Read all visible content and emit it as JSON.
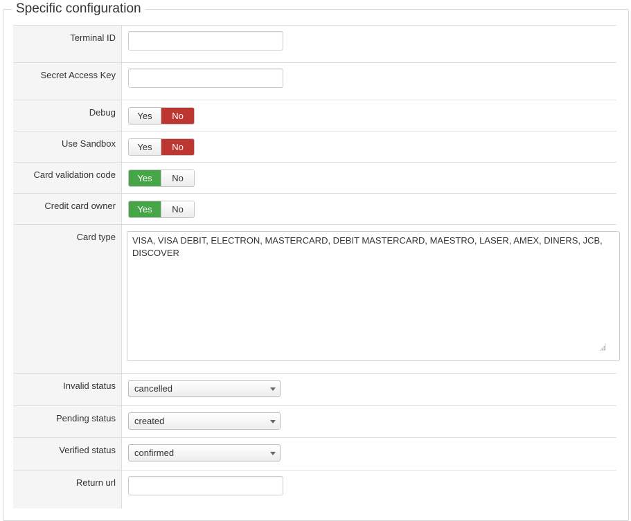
{
  "fieldset": {
    "legend": "Specific configuration"
  },
  "fields": {
    "terminal_id": {
      "label": "Terminal ID",
      "value": ""
    },
    "secret_access_key": {
      "label": "Secret Access Key",
      "value": ""
    },
    "debug": {
      "label": "Debug",
      "yes": "Yes",
      "no": "No",
      "selected": "No"
    },
    "use_sandbox": {
      "label": "Use Sandbox",
      "yes": "Yes",
      "no": "No",
      "selected": "No"
    },
    "card_validation_code": {
      "label": "Card validation code",
      "yes": "Yes",
      "no": "No",
      "selected": "Yes"
    },
    "credit_card_owner": {
      "label": "Credit card owner",
      "yes": "Yes",
      "no": "No",
      "selected": "Yes"
    },
    "card_type": {
      "label": "Card type",
      "value": "VISA, VISA DEBIT, ELECTRON, MASTERCARD, DEBIT MASTERCARD, MAESTRO, LASER, AMEX, DINERS, JCB, DISCOVER"
    },
    "invalid_status": {
      "label": "Invalid status",
      "selected": "cancelled"
    },
    "pending_status": {
      "label": "Pending status",
      "selected": "created"
    },
    "verified_status": {
      "label": "Verified status",
      "selected": "confirmed"
    },
    "return_url": {
      "label": "Return url",
      "value": ""
    }
  },
  "colors": {
    "danger": "#bd362f",
    "success": "#46a546",
    "label_bg": "#f5f5f5",
    "border": "#dddddd"
  },
  "icons": {
    "select_caret": "chevron-down-icon",
    "textarea_resize": "resize-grip-icon"
  }
}
